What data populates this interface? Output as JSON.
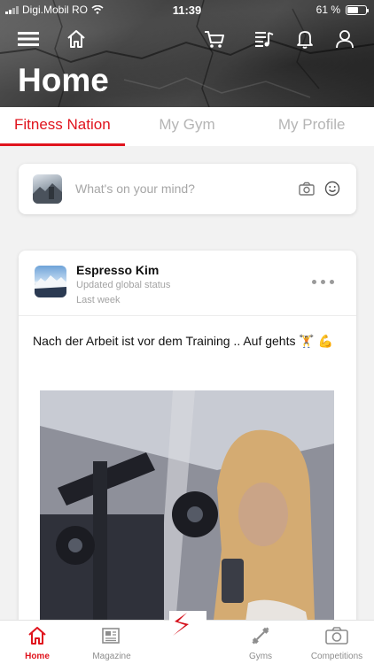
{
  "status_bar": {
    "carrier": "Digi.Mobil RO",
    "time": "11:39",
    "battery": "61 %",
    "battery_level": 0.61
  },
  "header": {
    "title": "Home",
    "icons": [
      "menu-icon",
      "home-icon",
      "cart-icon",
      "playlist-icon",
      "bell-icon",
      "user-icon"
    ]
  },
  "tabs": [
    {
      "label": "Fitness Nation",
      "active": true
    },
    {
      "label": "My Gym",
      "active": false
    },
    {
      "label": "My Profile",
      "active": false
    }
  ],
  "composer": {
    "placeholder": "What's on your mind?"
  },
  "post": {
    "author": "Espresso Kim",
    "subtitle": "Updated global status",
    "time": "Last week",
    "text": "Nach der Arbeit ist vor dem Training  .. Auf gehts 🏋️ 💪"
  },
  "bottom_nav": [
    {
      "label": "Home",
      "icon": "home-icon",
      "active": true
    },
    {
      "label": "Magazine",
      "icon": "newspaper-icon",
      "active": false
    },
    {
      "label": "",
      "icon": "brand-logo-icon",
      "active": false
    },
    {
      "label": "Gyms",
      "icon": "dumbbell-icon",
      "active": false
    },
    {
      "label": "Competitions",
      "icon": "camera-icon",
      "active": false
    }
  ],
  "colors": {
    "accent": "#e0141e",
    "inactive_tab": "#b5b5b5"
  }
}
